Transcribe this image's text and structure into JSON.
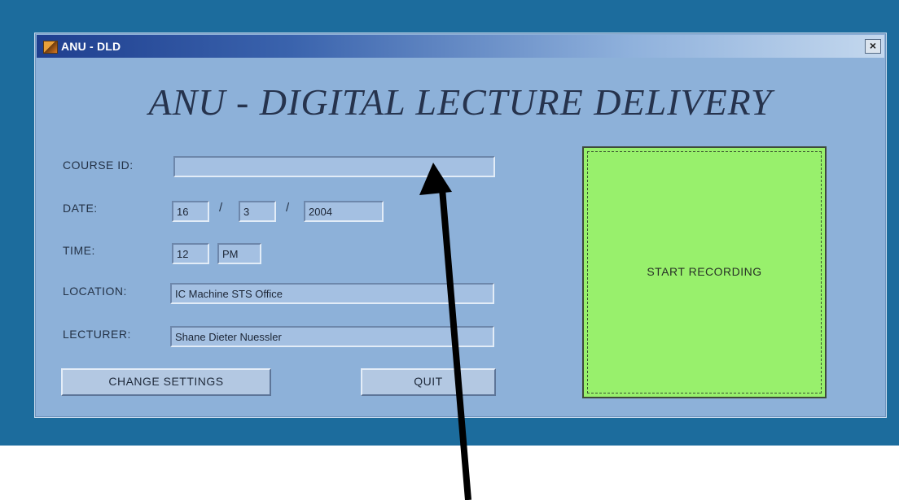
{
  "window": {
    "title": "ANU - DLD",
    "close_glyph": "×",
    "heading": "ANU - DIGITAL LECTURE DELIVERY"
  },
  "form": {
    "course_id": {
      "label": "COURSE ID:",
      "value": ""
    },
    "date": {
      "label": "DATE:",
      "day": "16",
      "month": "3",
      "year": "2004",
      "separator": "/"
    },
    "time": {
      "label": "TIME:",
      "hour": "12",
      "ampm": "PM"
    },
    "location": {
      "label": "LOCATION:",
      "value": "IC Machine STS Office"
    },
    "lecturer": {
      "label": "LECTURER:",
      "value": "Shane Dieter Nuessler"
    }
  },
  "buttons": {
    "change_settings": "CHANGE SETTINGS",
    "quit": "QUIT",
    "start_recording": "START RECORDING"
  },
  "colors": {
    "desktop": "#1c6c9d",
    "window": "#8db1d9",
    "record_button": "#98f06c",
    "arrow": "#000000"
  },
  "icons": [
    "app-icon",
    "close-icon",
    "annotation-arrow"
  ]
}
